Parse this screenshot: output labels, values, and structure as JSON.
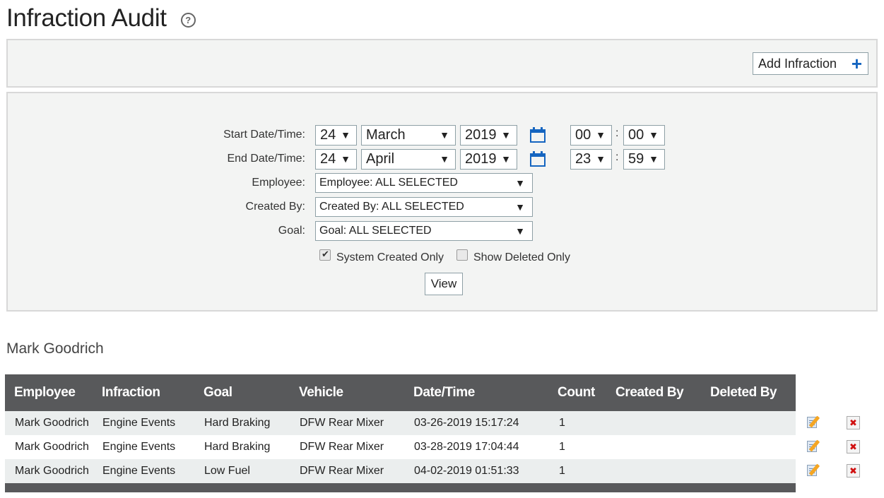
{
  "page": {
    "title": "Infraction Audit",
    "help_icon": "question-circle-icon"
  },
  "toolbar": {
    "add_label": "Add Infraction",
    "add_icon": "plus-icon",
    "add_icon_glyph": "+"
  },
  "filters": {
    "start": {
      "label": "Start Date/Time:",
      "day": "24",
      "month": "March",
      "year": "2019",
      "hour": "00",
      "minute": "00"
    },
    "end": {
      "label": "End Date/Time:",
      "day": "24",
      "month": "April",
      "year": "2019",
      "hour": "23",
      "minute": "59"
    },
    "time_separator": ":",
    "employee": {
      "label": "Employee:",
      "value": "Employee: ALL SELECTED"
    },
    "created_by": {
      "label": "Created By:",
      "value": "Created By: ALL SELECTED"
    },
    "goal": {
      "label": "Goal:",
      "value": "Goal: ALL SELECTED"
    },
    "system_created_only": {
      "label": "System Created Only",
      "checked": true
    },
    "show_deleted_only": {
      "label": "Show Deleted Only",
      "checked": false
    },
    "view_label": "View",
    "dropdown_arrow": "▼"
  },
  "section": {
    "heading": "Mark Goodrich"
  },
  "table": {
    "columns": [
      "Employee",
      "Infraction",
      "Goal",
      "Vehicle",
      "Date/Time",
      "Count",
      "Created By",
      "Deleted By"
    ],
    "rows": [
      [
        "Mark Goodrich",
        "Engine Events",
        "Hard Braking",
        "DFW Rear Mixer",
        "03-26-2019 15:17:24",
        "1",
        "",
        ""
      ],
      [
        "Mark Goodrich",
        "Engine Events",
        "Hard Braking",
        "DFW Rear Mixer",
        "03-28-2019 17:04:44",
        "1",
        "",
        ""
      ],
      [
        "Mark Goodrich",
        "Engine Events",
        "Low Fuel",
        "DFW Rear Mixer",
        "04-02-2019 01:51:33",
        "1",
        "",
        ""
      ]
    ],
    "row_actions": {
      "edit_icon": "edit-note-icon",
      "delete_icon": "delete-x-icon",
      "delete_glyph": "✖"
    }
  },
  "colors": {
    "header_bg": "#58595b",
    "panel_bg": "#f3f4f3",
    "accent": "#1565c0",
    "row_alt": "#ebeeee",
    "delete_red": "#d01010"
  }
}
